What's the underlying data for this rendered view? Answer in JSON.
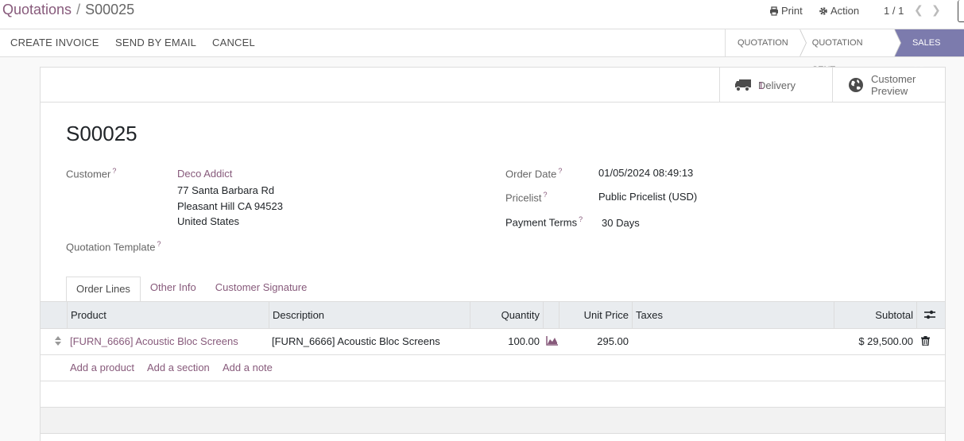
{
  "breadcrumb": {
    "parent": "Quotations",
    "separator": "/",
    "current": "S00025"
  },
  "toolbar": {
    "print_label": "Print",
    "action_label": "Action",
    "pager": "1 / 1"
  },
  "statusbar": {
    "buttons": [
      "CREATE INVOICE",
      "SEND BY EMAIL",
      "CANCEL"
    ],
    "stages": [
      "QUOTATION",
      "QUOTATION SENT",
      "SALES OR"
    ],
    "active_stage": "SALES OR"
  },
  "smart_buttons": {
    "delivery": {
      "value": "1",
      "label": "Delivery",
      "icon": "truck-icon"
    },
    "preview": {
      "label_1": "Customer",
      "label_2": "Preview",
      "icon": "globe-icon"
    }
  },
  "form": {
    "title": "S00025",
    "customer_label": "Customer",
    "customer_name": "Deco Addict",
    "customer_address": [
      "77 Santa Barbara Rd",
      "Pleasant Hill CA 94523",
      "United States"
    ],
    "quotation_template_label": "Quotation Template",
    "order_date_label": "Order Date",
    "order_date": "01/05/2024 08:49:13",
    "pricelist_label": "Pricelist",
    "pricelist": "Public Pricelist (USD)",
    "payment_terms_label": "Payment Terms",
    "payment_terms": "30 Days",
    "help_mark": "?"
  },
  "tabs": [
    "Order Lines",
    "Other Info",
    "Customer Signature"
  ],
  "table": {
    "columns": [
      "Product",
      "Description",
      "Quantity",
      "Unit Price",
      "Taxes",
      "Subtotal"
    ],
    "rows": [
      {
        "product": "[FURN_6666] Acoustic Bloc Screens",
        "description": "[FURN_6666] Acoustic Bloc Screens",
        "quantity": "100.00",
        "unit_price": "295.00",
        "taxes": "",
        "subtotal": "$ 29,500.00"
      }
    ],
    "add_links": [
      "Add a product",
      "Add a section",
      "Add a note"
    ]
  },
  "colors": {
    "accent": "#875a7b",
    "active_stage": "#7c7bad",
    "header_bg": "#e9ecef"
  }
}
